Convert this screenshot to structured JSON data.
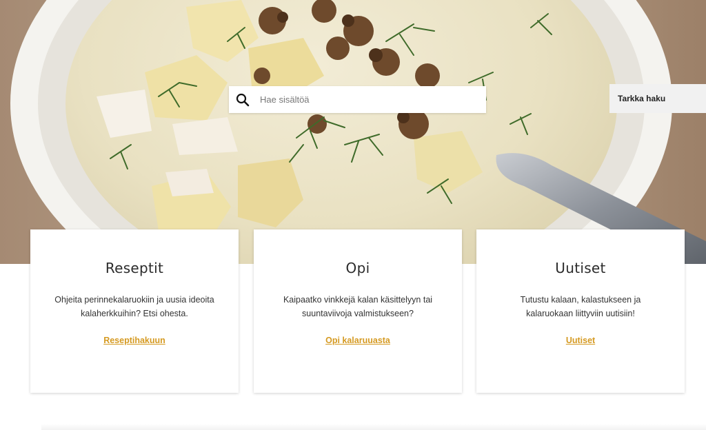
{
  "search": {
    "placeholder": "Hae sisältöä",
    "advanced_label": "Tarkka haku",
    "icon": "search-icon"
  },
  "cards": [
    {
      "title": "Reseptit",
      "text": "Ohjeita perinnekalaruokiin ja uusia ideoita kalaherkkuihin? Etsi ohesta.",
      "link": "Reseptihakuun"
    },
    {
      "title": "Opi",
      "text": "Kaipaatko vinkkejä kalan käsittelyyn tai suuntaviivoja valmistukseen?",
      "link": "Opi kalaruuasta"
    },
    {
      "title": "Uutiset",
      "text": "Tutustu kalaan, kalastukseen ja kalaruokaan liittyviin uutisiin!",
      "link": "Uutiset"
    }
  ],
  "colors": {
    "link": "#d59a22",
    "card_bg": "#ffffff",
    "advanced_bg": "#f1f1f1"
  }
}
